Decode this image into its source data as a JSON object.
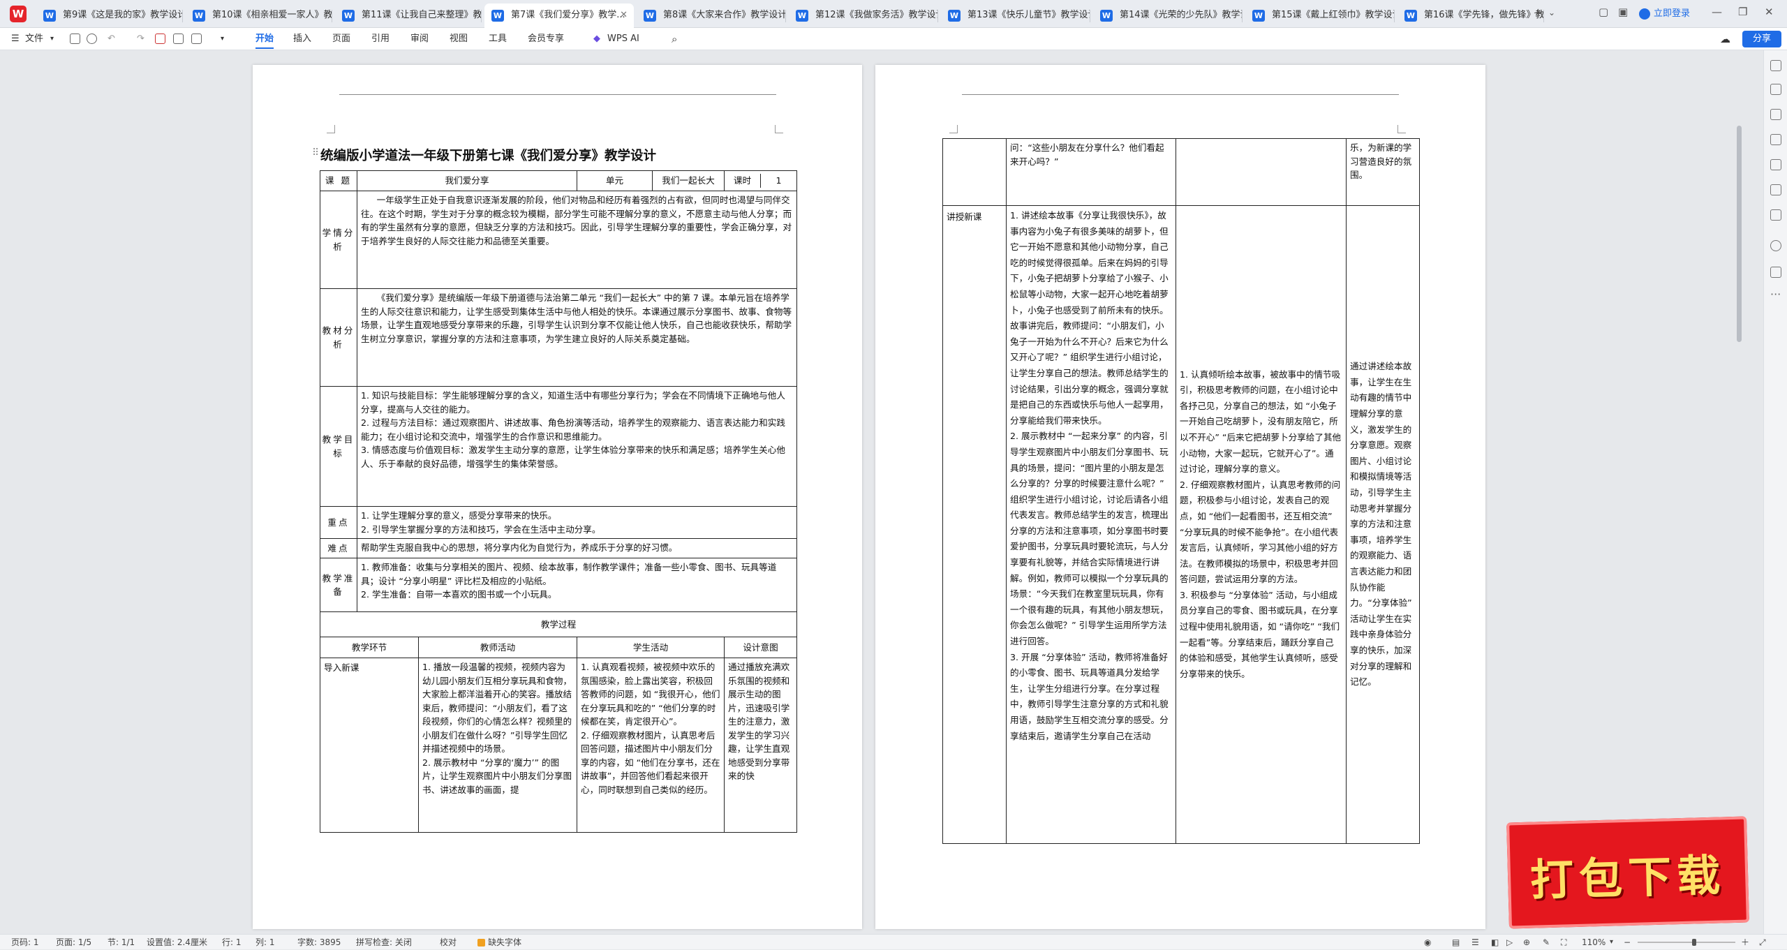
{
  "tabs": [
    {
      "label": "第9课《这是我的家》教学设计..."
    },
    {
      "label": "第10课《相亲相爱一家人》教学..."
    },
    {
      "label": "第11课《让我自己来整理》教学..."
    },
    {
      "label": "第7课《我们爱分享》教学..."
    },
    {
      "label": "第8课《大家来合作》教学设计..."
    },
    {
      "label": "第12课《我做家务活》教学设计..."
    },
    {
      "label": "第13课《快乐儿童节》教学设计..."
    },
    {
      "label": "第14课《光荣的少先队》教学设..."
    },
    {
      "label": "第15课《戴上红领巾》教学设计..."
    },
    {
      "label": "第16课《学先锋，做先锋》教学..."
    }
  ],
  "login_label": "立即登录",
  "ribbon": {
    "file": "文件",
    "items": [
      "开始",
      "插入",
      "页面",
      "引用",
      "审阅",
      "视图",
      "工具",
      "会员专享"
    ],
    "wps_ai": "WPS AI",
    "share": "分享"
  },
  "doc": {
    "title": "统编版小学道法一年级下册第七课《我们爱分享》教学设计",
    "meta": {
      "course_label": "课  题",
      "course": "我们爱分享",
      "unit_label": "单元",
      "unit": "我们一起长大",
      "hours_label": "课时",
      "hours": "1"
    },
    "rows": [
      {
        "label": "学情分析",
        "text": "一年级学生正处于自我意识逐渐发展的阶段，他们对物品和经历有着强烈的占有欲，但同时也渴望与同伴交往。在这个时期，学生对于分享的概念较为模糊，部分学生可能不理解分享的意义，不愿意主动与他人分享；而有的学生虽然有分享的意愿，但缺乏分享的方法和技巧。因此，引导学生理解分享的重要性，学会正确分享，对于培养学生良好的人际交往能力和品德至关重要。"
      },
      {
        "label": "教材分析",
        "text": "《我们爱分享》是统编版一年级下册道德与法治第二单元 “我们一起长大” 中的第 7 课。本单元旨在培养学生的人际交往意识和能力，让学生感受到集体生活中与他人相处的快乐。本课通过展示分享图书、故事、食物等场景，让学生直观地感受分享带来的乐趣，引导学生认识到分享不仅能让他人快乐，自己也能收获快乐，帮助学生树立分享意识，掌握分享的方法和注意事项，为学生建立良好的人际关系奠定基础。"
      },
      {
        "label": "教学目标",
        "lines": [
          "1. 知识与技能目标：学生能够理解分享的含义，知道生活中有哪些分享行为；学会在不同情境下正确地与他人分享，提高与人交往的能力。",
          "2. 过程与方法目标：通过观察图片、讲述故事、角色扮演等活动，培养学生的观察能力、语言表达能力和实践能力；在小组讨论和交流中，增强学生的合作意识和思维能力。",
          "3. 情感态度与价值观目标：激发学生主动分享的意愿，让学生体验分享带来的快乐和满足感；培养学生关心他人、乐于奉献的良好品德，增强学生的集体荣誉感。"
        ]
      },
      {
        "label": "重点",
        "lines": [
          "1. 让学生理解分享的意义，感受分享带来的快乐。",
          "2. 引导学生掌握分享的方法和技巧，学会在生活中主动分享。"
        ]
      },
      {
        "label": "难点",
        "text": "帮助学生克服自我中心的思想，将分享内化为自觉行为，养成乐于分享的好习惯。"
      },
      {
        "label": "教学准备",
        "lines": [
          "1. 教师准备：收集与分享相关的图片、视频、绘本故事，制作教学课件；准备一些小零食、图书、玩具等道具；设计 “分享小明星” 评比栏及相应的小贴纸。",
          "2. 学生准备：自带一本喜欢的图书或一个小玩具。"
        ]
      }
    ],
    "process_title": "教学过程",
    "process_headers": [
      "教学环节",
      "教师活动",
      "学生活动",
      "设计意图"
    ],
    "intro": {
      "stage": "导入新课",
      "teacher": "1. 播放一段温馨的视频，视频内容为幼儿园小朋友们互相分享玩具和食物，大家脸上都洋溢着开心的笑容。播放结束后，教师提问：“小朋友们，看了这段视频，你们的心情怎么样？视频里的小朋友们在做什么呀？”引导学生回忆并描述视频中的场景。\n2. 展示教材中 “分享的‘魔力’” 的图片，让学生观察图片中小朋友们分享图书、讲述故事的画面，提",
      "student": "1. 认真观看视频，被视频中欢乐的氛围感染，脸上露出笑容，积极回答教师的问题，如 “我很开心，他们在分享玩具和吃的” “他们分享的时候都在笑，肯定很开心”。\n2. 仔细观察教材图片，认真思考后回答问题，描述图片中小朋友们分享的内容，如 “他们在分享书，还在讲故事”，并回答他们看起来很开心，同时联想到自己类似的经历。",
      "intent": "通过播放充满欢乐氛围的视频和展示生动的图片，迅速吸引学生的注意力，激发学生的学习兴趣，让学生直观地感受到分享带来的快"
    },
    "p2_cont": {
      "teacher": "问：“这些小朋友在分享什么？他们看起来开心吗？”",
      "student": "",
      "intent": "乐，为新课的学习营造良好的氛围。"
    },
    "lesson": {
      "stage": "讲授新课",
      "teacher": "1. 讲述绘本故事《分享让我很快乐》，故事内容为小兔子有很多美味的胡萝卜，但它一开始不愿意和其他小动物分享，自己吃的时候觉得很孤单。后来在妈妈的引导下，小兔子把胡萝卜分享给了小猴子、小松鼠等小动物，大家一起开心地吃着胡萝卜，小兔子也感受到了前所未有的快乐。故事讲完后，教师提问：“小朋友们，小兔子一开始为什么不开心？后来它为什么又开心了呢？” 组织学生进行小组讨论，让学生分享自己的想法。教师总结学生的讨论结果，引出分享的概念，强调分享就是把自己的东西或快乐与他人一起享用，分享能给我们带来快乐。\n2. 展示教材中 “一起来分享” 的内容，引导学生观察图片中小朋友们分享图书、玩具的场景，提问：“图片里的小朋友是怎么分享的？分享的时候要注意什么呢？” 组织学生进行小组讨论，讨论后请各小组代表发言。教师总结学生的发言，梳理出分享的方法和注意事项，如分享图书时要爱护图书，分享玩具时要轮流玩，与人分享要有礼貌等，并结合实际情境进行讲解。例如，教师可以模拟一个分享玩具的场景：“今天我们在教室里玩玩具，你有一个很有趣的玩具，有其他小朋友想玩，你会怎么做呢？” 引导学生运用所学方法进行回答。\n3. 开展 “分享体验” 活动，教师将准备好的小零食、图书、玩具等道具分发给学生，让学生分组进行分享。在分享过程中，教师引导学生注意分享的方式和礼貌用语，鼓励学生互相交流分享的感受。分享结束后，邀请学生分享自己在活动",
      "student": "1. 认真倾听绘本故事，被故事中的情节吸引，积极思考教师的问题，在小组讨论中各抒己见，分享自己的想法，如 “小兔子一开始自己吃胡萝卜，没有朋友陪它，所以不开心” “后来它把胡萝卜分享给了其他小动物，大家一起玩，它就开心了”。通过讨论，理解分享的意义。\n2. 仔细观察教材图片，认真思考教师的问题，积极参与小组讨论，发表自己的观点，如 “他们一起看图书，还互相交流” “分享玩具的时候不能争抢”。在小组代表发言后，认真倾听，学习其他小组的好方法。在教师模拟的场景中，积极思考并回答问题，尝试运用分享的方法。\n3. 积极参与 “分享体验” 活动，与小组成员分享自己的零食、图书或玩具，在分享过程中使用礼貌用语，如 “请你吃” “我们一起看”等。分享结束后，踊跃分享自己的体验和感受，其他学生认真倾听，感受分享带来的快乐。",
      "intent": "通过讲述绘本故事，让学生在生动有趣的情节中理解分享的意义，激发学生的分享意愿。观察图片、小组讨论和模拟情境等活动，引导学生主动思考并掌握分享的方法和注意事项，培养学生的观察能力、语言表达能力和团队协作能力。“分享体验” 活动让学生在实践中亲身体验分享的快乐，加深对分享的理解和记忆。"
    }
  },
  "statusbar": {
    "page": "页码: 1",
    "pages": "页面: 1/5",
    "section": "节: 1/1",
    "setting": "设置值: 2.4厘米",
    "row": "行: 1",
    "col": "列: 1",
    "words": "字数: 3895",
    "spell": "拼写检查: 关闭",
    "proof": "校对",
    "missing_font": "缺失字体",
    "zoom": "110%"
  },
  "banner": "打包下载"
}
